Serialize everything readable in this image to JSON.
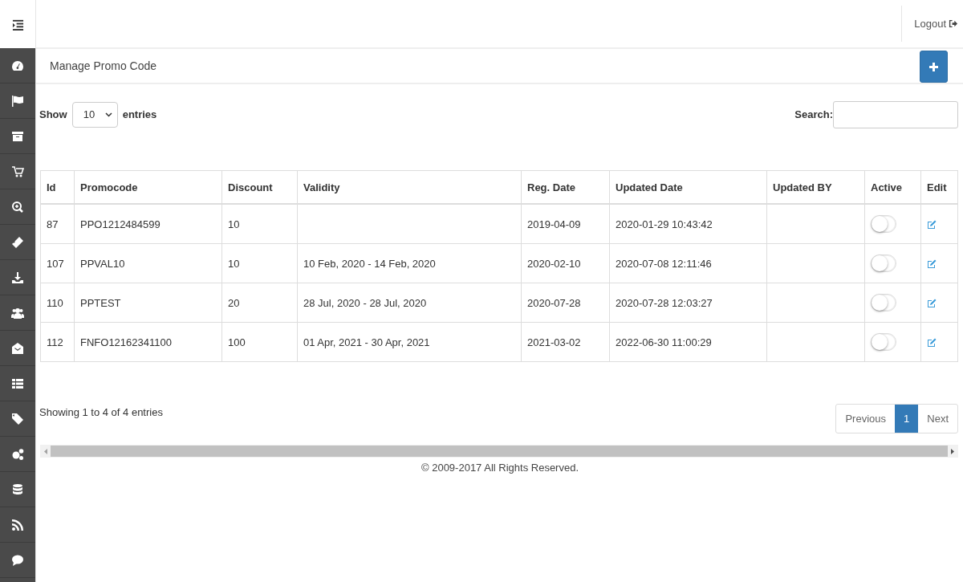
{
  "topbar": {
    "logout": "Logout"
  },
  "page": {
    "title": "Manage Promo Code"
  },
  "length_control": {
    "show_label": "Show",
    "value": "10",
    "entries_label": "entries"
  },
  "search": {
    "label": "Search:"
  },
  "table": {
    "columns": [
      "Id",
      "Promocode",
      "Discount",
      "Validity",
      "Reg. Date",
      "Updated Date",
      "Updated BY",
      "Active",
      "Edit"
    ],
    "rows": [
      {
        "id": "87",
        "promocode": "PPO1212484599",
        "discount": "10",
        "validity": "",
        "reg_date": "2019-04-09",
        "updated_date": "2020-01-29 10:43:42",
        "updated_by": "",
        "active": false
      },
      {
        "id": "107",
        "promocode": "PPVAL10",
        "discount": "10",
        "validity": "10 Feb, 2020 - 14 Feb, 2020",
        "reg_date": "2020-02-10",
        "updated_date": "2020-07-08 12:11:46",
        "updated_by": "",
        "active": false
      },
      {
        "id": "110",
        "promocode": "PPTEST",
        "discount": "20",
        "validity": "28 Jul, 2020 - 28 Jul, 2020",
        "reg_date": "2020-07-28",
        "updated_date": "2020-07-28 12:03:27",
        "updated_by": "",
        "active": false
      },
      {
        "id": "112",
        "promocode": "FNFO12162341100",
        "discount": "100",
        "validity": "01 Apr, 2021 - 30 Apr, 2021",
        "reg_date": "2021-03-02",
        "updated_date": "2022-06-30 11:00:29",
        "updated_by": "",
        "active": false
      }
    ]
  },
  "info": "Showing 1 to 4 of 4 entries",
  "pagination": [
    {
      "label": "Previous",
      "kind": "nav",
      "selected": false
    },
    {
      "label": "1",
      "kind": "page",
      "selected": true
    },
    {
      "label": "Next",
      "kind": "nav",
      "selected": false
    }
  ],
  "footer": "© 2009-2017 All Rights Reserved."
}
